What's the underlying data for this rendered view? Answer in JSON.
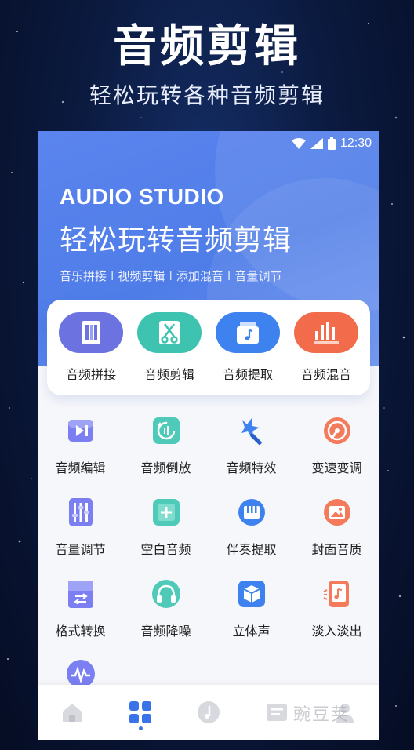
{
  "promo": {
    "title": "音频剪辑",
    "subtitle": "轻松玩转各种音频剪辑"
  },
  "status_bar": {
    "time": "12:30",
    "icons": [
      "wifi-icon",
      "signal-icon",
      "battery-icon"
    ]
  },
  "hero": {
    "brand": "AUDIO STUDIO",
    "title": "轻松玩转音频剪辑",
    "tags": [
      "音乐拼接",
      "视频剪辑",
      "添加混音",
      "音量调节"
    ],
    "tag_separator": "I"
  },
  "top_features": [
    {
      "label": "音频拼接",
      "icon": "audio-splice-icon",
      "color": "#6c73e0"
    },
    {
      "label": "音频剪辑",
      "icon": "scissors-icon",
      "color": "#3fc3b1"
    },
    {
      "label": "音频提取",
      "icon": "extract-music-icon",
      "color": "#3e82ef"
    },
    {
      "label": "音频混音",
      "icon": "mixer-icon",
      "color": "#f26b4b"
    }
  ],
  "grid_features": [
    [
      {
        "label": "音频编辑",
        "icon": "play-edit-icon"
      },
      {
        "label": "音频倒放",
        "icon": "reverse-icon"
      },
      {
        "label": "音频特效",
        "icon": "magic-wand-icon"
      },
      {
        "label": "变速变调",
        "icon": "speed-icon"
      }
    ],
    [
      {
        "label": "音量调节",
        "icon": "volume-sliders-icon"
      },
      {
        "label": "空白音频",
        "icon": "add-blank-icon"
      },
      {
        "label": "伴奏提取",
        "icon": "piano-icon"
      },
      {
        "label": "封面音质",
        "icon": "cover-image-icon"
      }
    ],
    [
      {
        "label": "格式转换",
        "icon": "format-convert-icon"
      },
      {
        "label": "音频降噪",
        "icon": "headphones-icon"
      },
      {
        "label": "立体声",
        "icon": "stereo-cube-icon"
      },
      {
        "label": "淡入淡出",
        "icon": "fade-icon"
      }
    ]
  ],
  "bottom_nav": [
    {
      "name": "home",
      "icon": "home-icon",
      "active": false
    },
    {
      "name": "tools",
      "icon": "grid-icon",
      "active": true
    },
    {
      "name": "music",
      "icon": "music-note-icon",
      "active": false
    },
    {
      "name": "list",
      "icon": "list-icon",
      "active": false
    },
    {
      "name": "profile",
      "icon": "profile-icon",
      "active": false
    }
  ],
  "watermark": "豌豆荚",
  "colors": {
    "hero_blue": "#4f7de8",
    "accent_blue": "#3a73e8",
    "teal": "#3fc3b1",
    "orange": "#f26b4b",
    "purple": "#6c73e0"
  }
}
